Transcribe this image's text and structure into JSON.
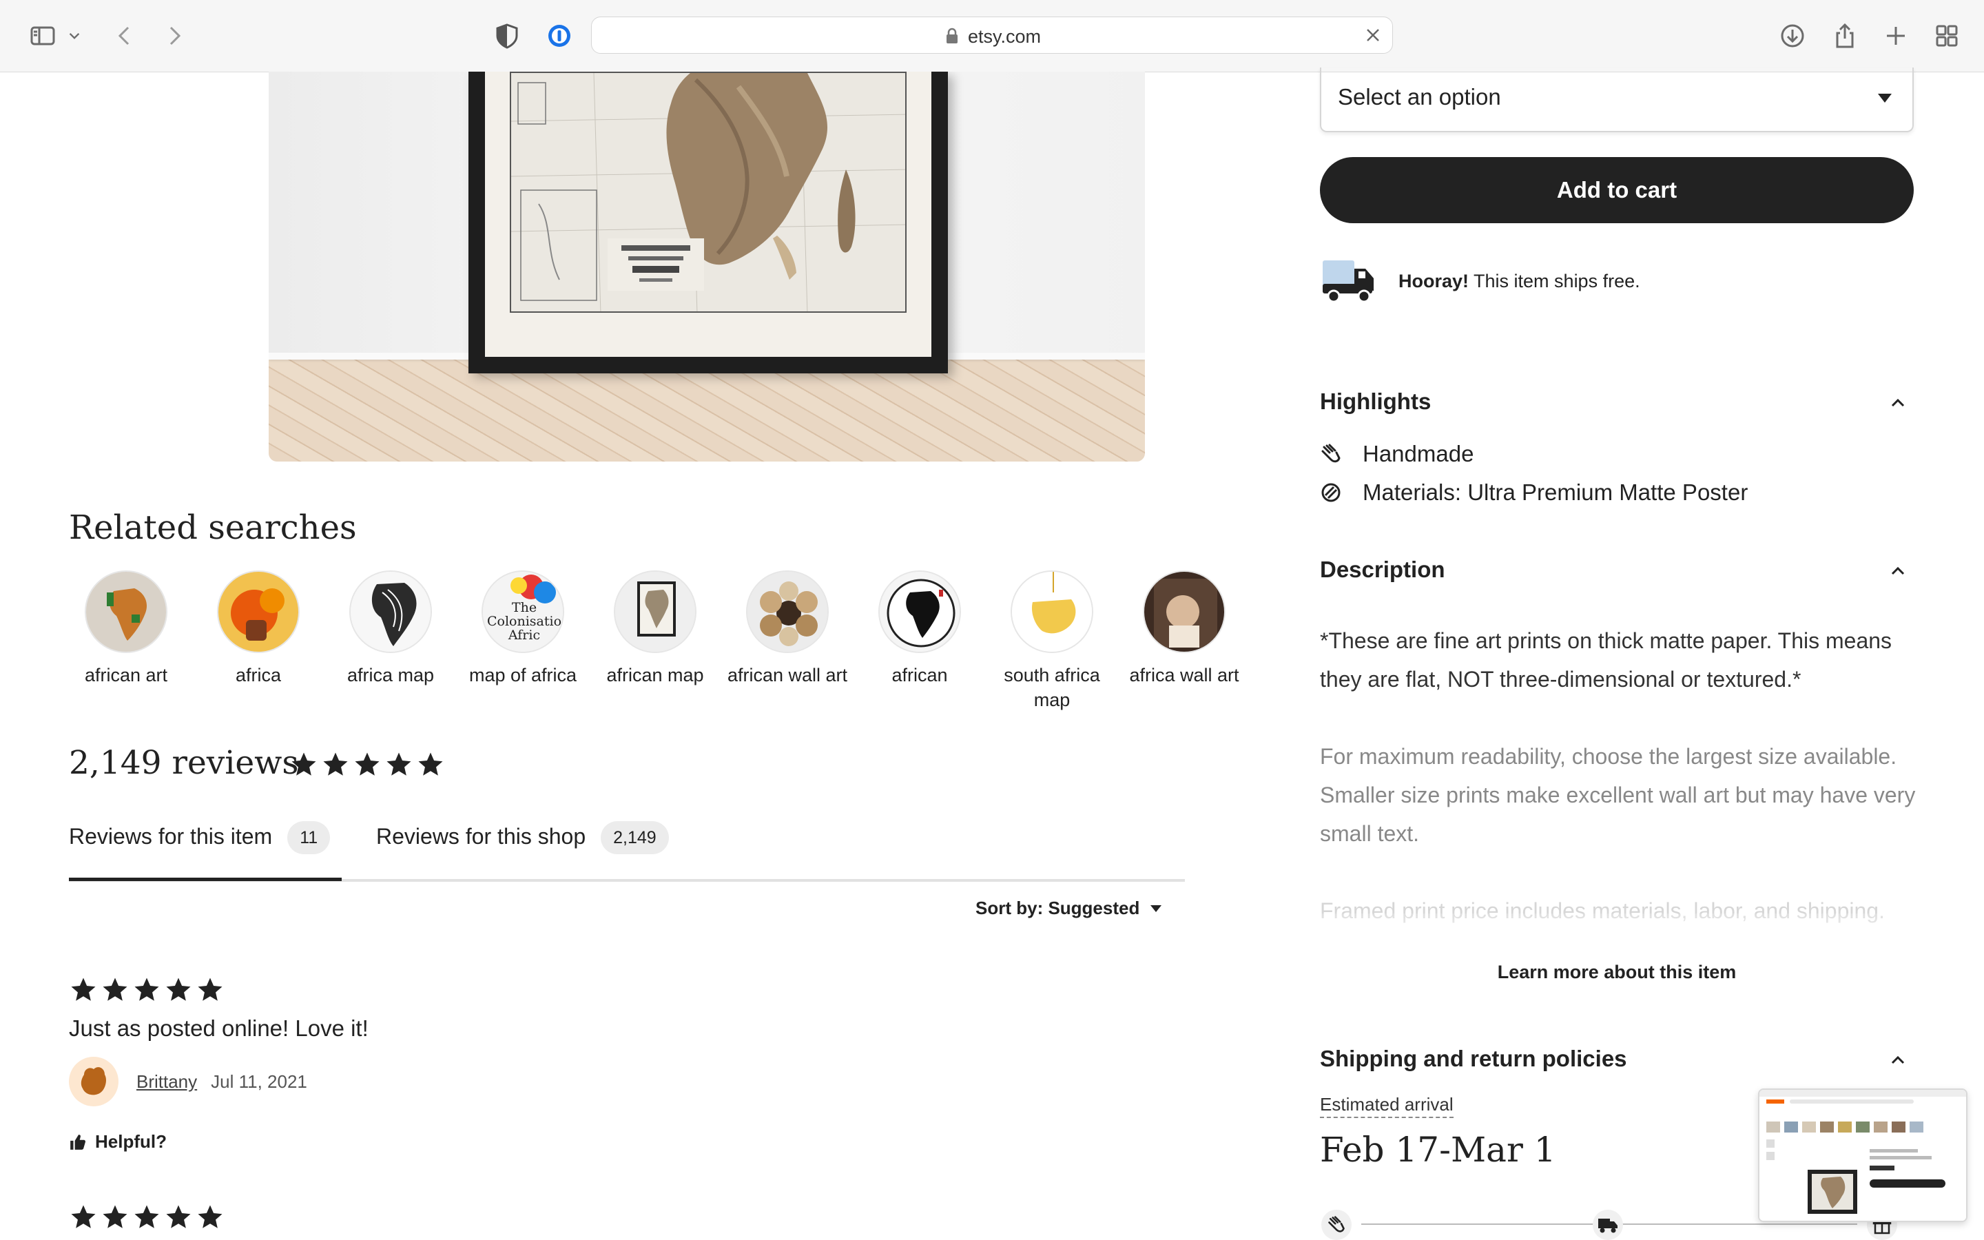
{
  "browser": {
    "url": "etsy.com"
  },
  "related": {
    "title": "Related searches",
    "items": [
      {
        "label": "african art"
      },
      {
        "label": "africa"
      },
      {
        "label": "africa map"
      },
      {
        "label": "map of africa",
        "image_text": "The Colonisatio Afric"
      },
      {
        "label": "african map"
      },
      {
        "label": "african wall art"
      },
      {
        "label": "african"
      },
      {
        "label": "south africa map"
      },
      {
        "label": "africa wall art"
      }
    ]
  },
  "reviews": {
    "count_label": "2,149 reviews",
    "rating_stars": 5,
    "tabs": [
      {
        "label": "Reviews for this item",
        "count": "11"
      },
      {
        "label": "Reviews for this shop",
        "count": "2,149"
      }
    ],
    "sort_label": "Sort by: Suggested",
    "list": [
      {
        "stars": 5,
        "text": "Just as posted online! Love it!",
        "reviewer": "Brittany",
        "date": "Jul 11, 2021",
        "helpful_label": "Helpful?"
      },
      {
        "stars": 5
      }
    ]
  },
  "purchase": {
    "select_placeholder": "Select an option",
    "cart_label": "Add to cart",
    "ship_bold": "Hooray!",
    "ship_text": " This item ships free."
  },
  "highlights": {
    "title": "Highlights",
    "items": [
      {
        "icon": "hand-icon",
        "label": "Handmade"
      },
      {
        "icon": "materials-icon",
        "label": "Materials: Ultra Premium Matte Poster"
      }
    ]
  },
  "description": {
    "title": "Description",
    "paragraphs": [
      "*These are fine art prints on thick matte paper. This means they are flat, NOT three-dimensional or textured.*",
      "For maximum readability, choose the largest size available. Smaller size prints make excellent wall art but may have very small text.",
      "Framed print price includes materials, labor, and shipping."
    ],
    "learn_more": "Learn more about this item"
  },
  "shipping": {
    "title": "Shipping and return policies",
    "estimated_label": "Estimated arrival",
    "estimated_date": "Feb 17-Mar 1"
  },
  "colors": {
    "text": "#222222",
    "cart_bg": "#222222",
    "badge_bg": "#ececec",
    "muted": "#888888"
  }
}
